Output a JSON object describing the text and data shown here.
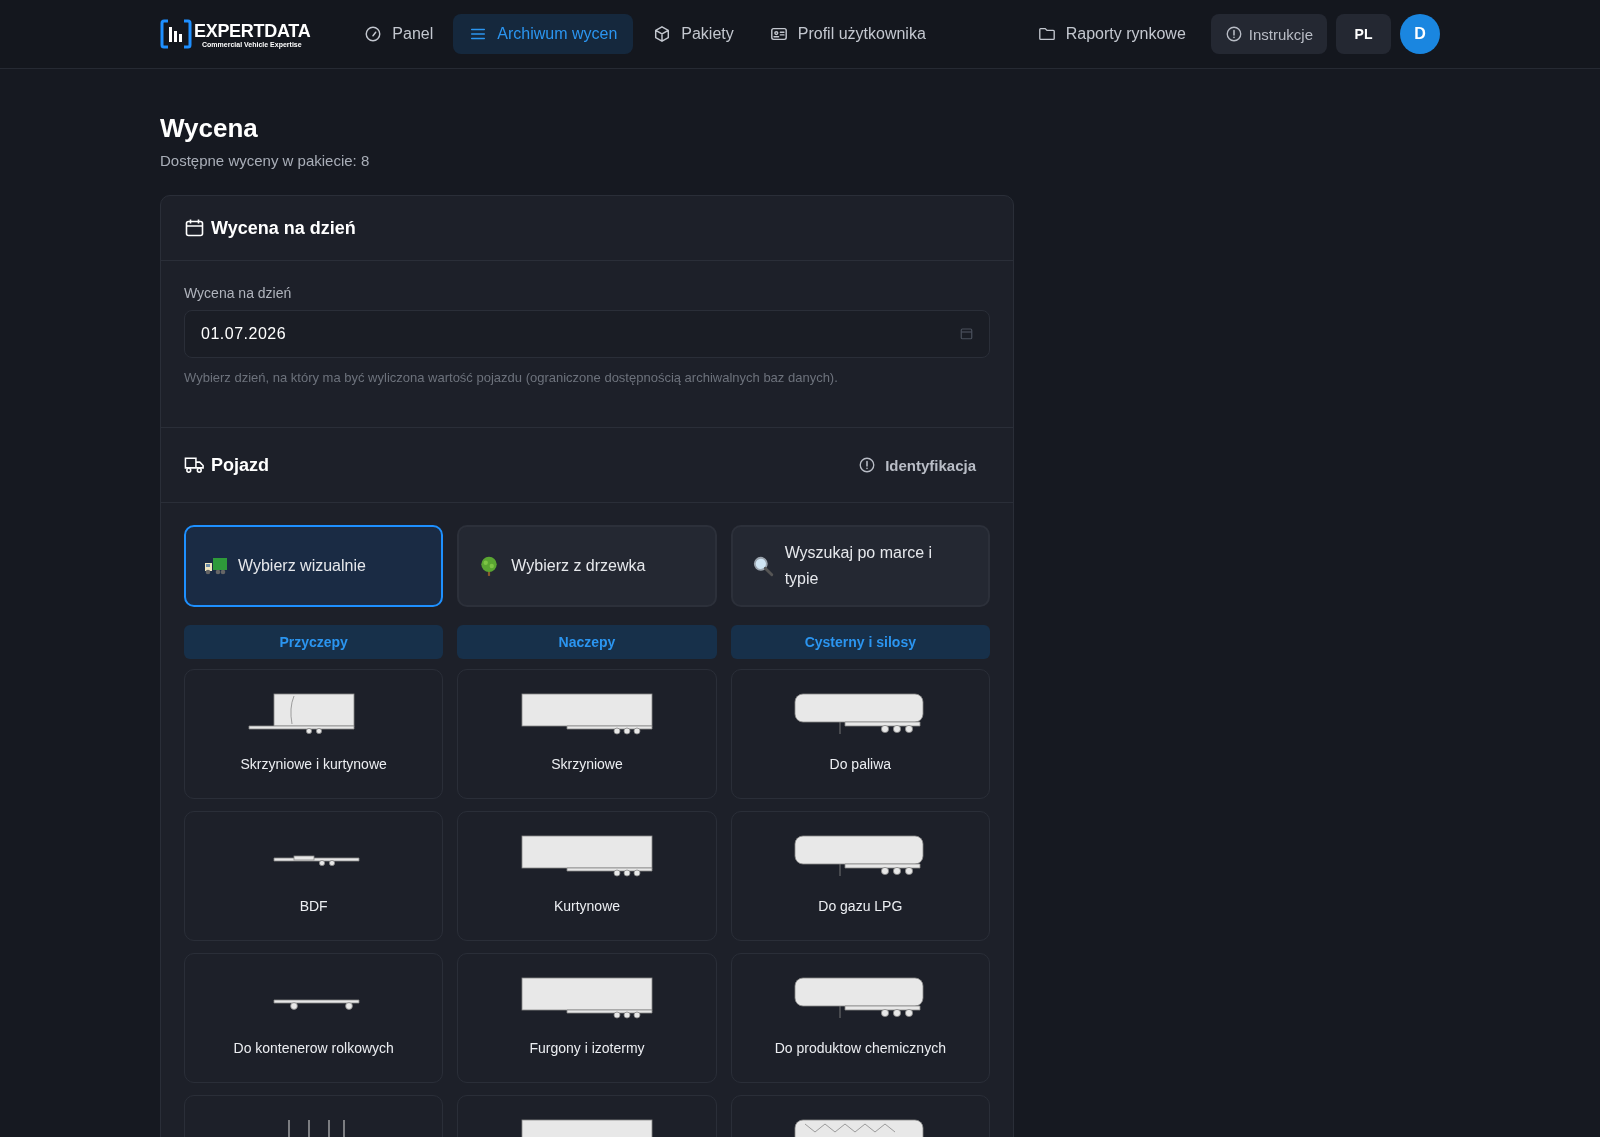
{
  "nav": {
    "logo": {
      "name": "EXPERTDATA",
      "tagline": "Commercial Vehicle Expertise"
    },
    "items": [
      {
        "label": "Panel",
        "kind": "gauge",
        "selected": false
      },
      {
        "label": "Archiwum wycen",
        "kind": "list",
        "selected": true
      },
      {
        "label": "Pakiety",
        "kind": "box",
        "selected": false
      },
      {
        "label": "Profil użytkownika",
        "kind": "card",
        "selected": false
      }
    ],
    "right": {
      "reports": "Raporty rynkowe",
      "help": "Instrukcje",
      "language": "PL",
      "avatar": "D"
    }
  },
  "page": {
    "title": "Wycena",
    "subtitle": "Dostępne wyceny w pakiecie: 8"
  },
  "date_section": {
    "title": "Wycena na dzień",
    "label": "Wycena na dzień",
    "value": "01.07.2026",
    "hint": "Wybierz dzień, na który ma być wyliczona wartość pojazdu (ograniczone dostępnością archiwalnych baz danych)."
  },
  "vehicle_section": {
    "title": "Pojazd",
    "action": "Identyfikacja",
    "methods": [
      {
        "label": "Wybierz wizualnie",
        "kind": "visual",
        "selected": true
      },
      {
        "label": "Wybierz z drzewka",
        "kind": "tree",
        "selected": false
      },
      {
        "label": "Wyszukaj po marce i typie",
        "kind": "search",
        "selected": false
      }
    ],
    "categories": [
      {
        "label": "Przyczepy",
        "tiles": [
          {
            "label": "Skrzyniowe i kurtynowe",
            "kind": "drawbar-box"
          },
          {
            "label": "BDF",
            "kind": "drawbar-flat"
          },
          {
            "label": "Do kontenerow rolkowych",
            "kind": "drawbar-container"
          },
          {
            "kind": "stakes"
          }
        ]
      },
      {
        "label": "Naczepy",
        "tiles": [
          {
            "label": "Skrzyniowe",
            "kind": "semi-box"
          },
          {
            "label": "Kurtynowe",
            "kind": "semi-box"
          },
          {
            "label": "Furgony i izotermy",
            "kind": "semi-box"
          },
          {
            "kind": "semi-box"
          }
        ]
      },
      {
        "label": "Cysterny i silosy",
        "tiles": [
          {
            "label": "Do paliwa",
            "kind": "tank"
          },
          {
            "label": "Do gazu LPG",
            "kind": "tank"
          },
          {
            "label": "Do produktow chemicznych",
            "kind": "tank"
          },
          {
            "kind": "silo"
          }
        ]
      }
    ]
  }
}
